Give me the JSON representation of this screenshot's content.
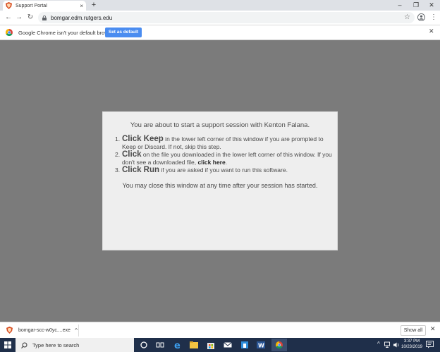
{
  "browser": {
    "tab_title": "Support Portal",
    "tab_close": "×",
    "new_tab": "+",
    "window_min": "–",
    "window_restore": "❐",
    "window_close": "✕",
    "back": "←",
    "forward": "→",
    "reload": "↻",
    "url": "bomgar.edm.rutgers.edu",
    "bookmark_star": "☆",
    "menu": "⋮"
  },
  "infobar": {
    "message": "Google Chrome isn't your default browser",
    "button": "Set as default",
    "close": "✕"
  },
  "dialog": {
    "intro": "You are about to start a support session with Kenton Falana.",
    "steps": [
      {
        "num": "1.",
        "lead": "Click Keep",
        "text": " in the lower left corner of this window if you are prompted to Keep or Discard. If not, skip this step."
      },
      {
        "num": "2.",
        "lead": "Click",
        "text": " on the file you downloaded in the lower left corner of this window. If you don't see a downloaded file, ",
        "link": "click here",
        "tail": "."
      },
      {
        "num": "3.",
        "lead": "Click Run",
        "text": " if you are asked if you want to run this software."
      }
    ],
    "closing": "You may close this window at any time after your session has started."
  },
  "downloads": {
    "file_name": "bomgar-scc-w0yc....exe",
    "chevron": "^",
    "show_all": "Show all",
    "close": "✕"
  },
  "taskbar": {
    "search_placeholder": "Type here to search",
    "tray_chevron": "^",
    "clock_time": "3:37 PM",
    "clock_date": "10/23/2019"
  },
  "colors": {
    "accent_button": "#4a8cf0",
    "page_background": "#7b7b7b",
    "dialog_background": "#eeeeee",
    "taskbar": "#1f2f4a"
  }
}
